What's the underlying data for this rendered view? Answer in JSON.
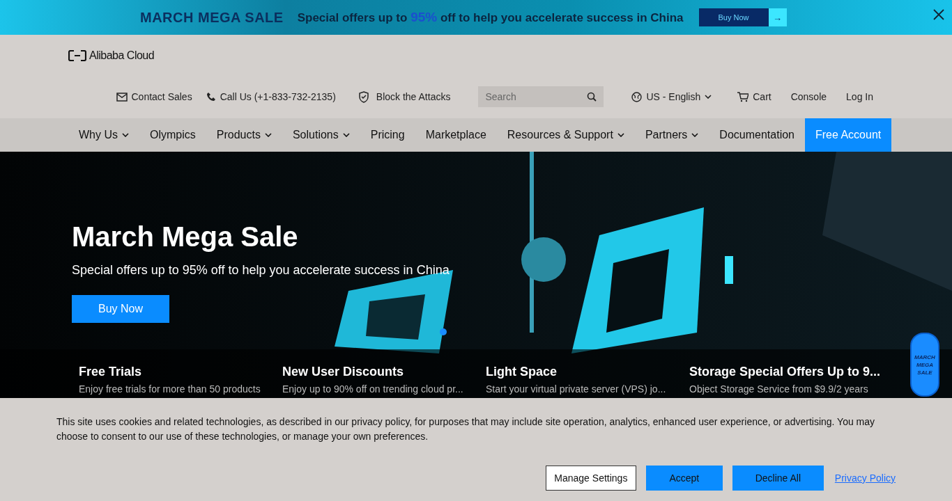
{
  "promo_bar": {
    "title": "MARCH MEGA SALE",
    "text_before": "Special offers up to",
    "highlight": "95%",
    "text_after": "off to help you accelerate success in China",
    "button": "Buy Now",
    "arrow": "→"
  },
  "header": {
    "logo": "Alibaba Cloud",
    "utility_links": [
      {
        "kind": "mail",
        "label": "Contact Sales"
      },
      {
        "kind": "phone",
        "label": "Call Us (+1-833-732-2135)"
      },
      {
        "kind": "shield",
        "label": "Block the Attacks"
      }
    ],
    "search": {
      "placeholder": "Search"
    },
    "language": "US - English",
    "cart": "Cart",
    "console": "Console",
    "login": "Log In"
  },
  "nav": [
    {
      "label": "Why Us",
      "dropdown": true,
      "highlighted": false
    },
    {
      "label": "Olympics",
      "dropdown": false,
      "highlighted": false
    },
    {
      "label": "Products",
      "dropdown": true,
      "highlighted": false
    },
    {
      "label": "Solutions",
      "dropdown": true,
      "highlighted": false
    },
    {
      "label": "Pricing",
      "dropdown": false,
      "highlighted": false
    },
    {
      "label": "Marketplace",
      "dropdown": false,
      "highlighted": false
    },
    {
      "label": "Resources & Support",
      "dropdown": true,
      "highlighted": false
    },
    {
      "label": "Partners",
      "dropdown": true,
      "highlighted": false
    },
    {
      "label": "Documentation",
      "dropdown": false,
      "highlighted": false
    },
    {
      "label": "Free Account",
      "dropdown": false,
      "highlighted": true
    }
  ],
  "hero": {
    "title": "March Mega Sale",
    "subtitle": "Special offers up to 95% off to help you accelerate success in China",
    "button": "Buy Now",
    "cards": [
      {
        "title": "Free Trials",
        "text": "Enjoy free trials for more than 50 products"
      },
      {
        "title": "New User Discounts",
        "text": "Enjoy up to 90% off on trending cloud pr..."
      },
      {
        "title": "Light Space",
        "text": "Start your virtual private server (VPS) jo..."
      },
      {
        "title": "Storage Special Offers Up to 9...",
        "text": "Object Storage Service from $9.9/2 years"
      }
    ],
    "floating_badge": [
      "MARCH",
      "MEGA",
      "SALE"
    ]
  },
  "cookie_banner": {
    "text": "This site uses cookies and related technologies, as described in our privacy policy, for purposes that may include site operation, analytics, enhanced user experience, or advertising. You may choose to consent to our use of these technologies, or manage your own preferences.",
    "buttons": [
      {
        "kind": "outline",
        "label": "Manage Settings"
      },
      {
        "kind": "primary",
        "label": "Accept"
      },
      {
        "kind": "primary",
        "label": "Decline All"
      },
      {
        "kind": "link",
        "label": "Privacy Policy"
      }
    ]
  }
}
